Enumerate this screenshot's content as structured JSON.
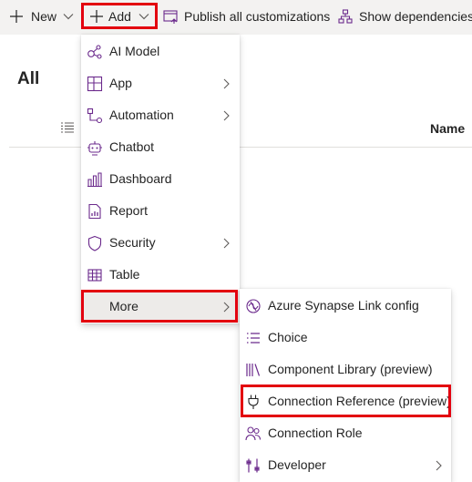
{
  "toolbar": {
    "new_label": "New",
    "add_label": "Add",
    "publish_label": "Publish all customizations",
    "show_dependencies_label": "Show dependencies"
  },
  "view": {
    "title": "All",
    "name_column": "Name"
  },
  "add_menu": {
    "items": [
      {
        "label": "AI Model",
        "icon": "ai-model-icon",
        "submenu": false
      },
      {
        "label": "App",
        "icon": "app-icon",
        "submenu": true
      },
      {
        "label": "Automation",
        "icon": "automation-icon",
        "submenu": true
      },
      {
        "label": "Chatbot",
        "icon": "chatbot-icon",
        "submenu": false
      },
      {
        "label": "Dashboard",
        "icon": "dashboard-icon",
        "submenu": false
      },
      {
        "label": "Report",
        "icon": "report-icon",
        "submenu": false
      },
      {
        "label": "Security",
        "icon": "security-icon",
        "submenu": true
      },
      {
        "label": "Table",
        "icon": "table-icon",
        "submenu": false
      },
      {
        "label": "More",
        "icon": "",
        "submenu": true,
        "selected": true
      }
    ]
  },
  "more_menu": {
    "items": [
      {
        "label": "Azure Synapse Link config",
        "icon": "azure-synapse-icon",
        "submenu": false
      },
      {
        "label": "Choice",
        "icon": "choice-icon",
        "submenu": false
      },
      {
        "label": "Component Library (preview)",
        "icon": "component-library-icon",
        "submenu": false
      },
      {
        "label": "Connection Reference (preview)",
        "icon": "plug-icon",
        "submenu": false
      },
      {
        "label": "Connection Role",
        "icon": "connection-role-icon",
        "submenu": false
      },
      {
        "label": "Developer",
        "icon": "developer-icon",
        "submenu": true
      }
    ]
  },
  "colors": {
    "icon_purple": "#6b2a8c",
    "highlight_red": "#e3000f",
    "toolbar_bg": "#f3f2f1",
    "selected_bg": "#edebe9"
  }
}
